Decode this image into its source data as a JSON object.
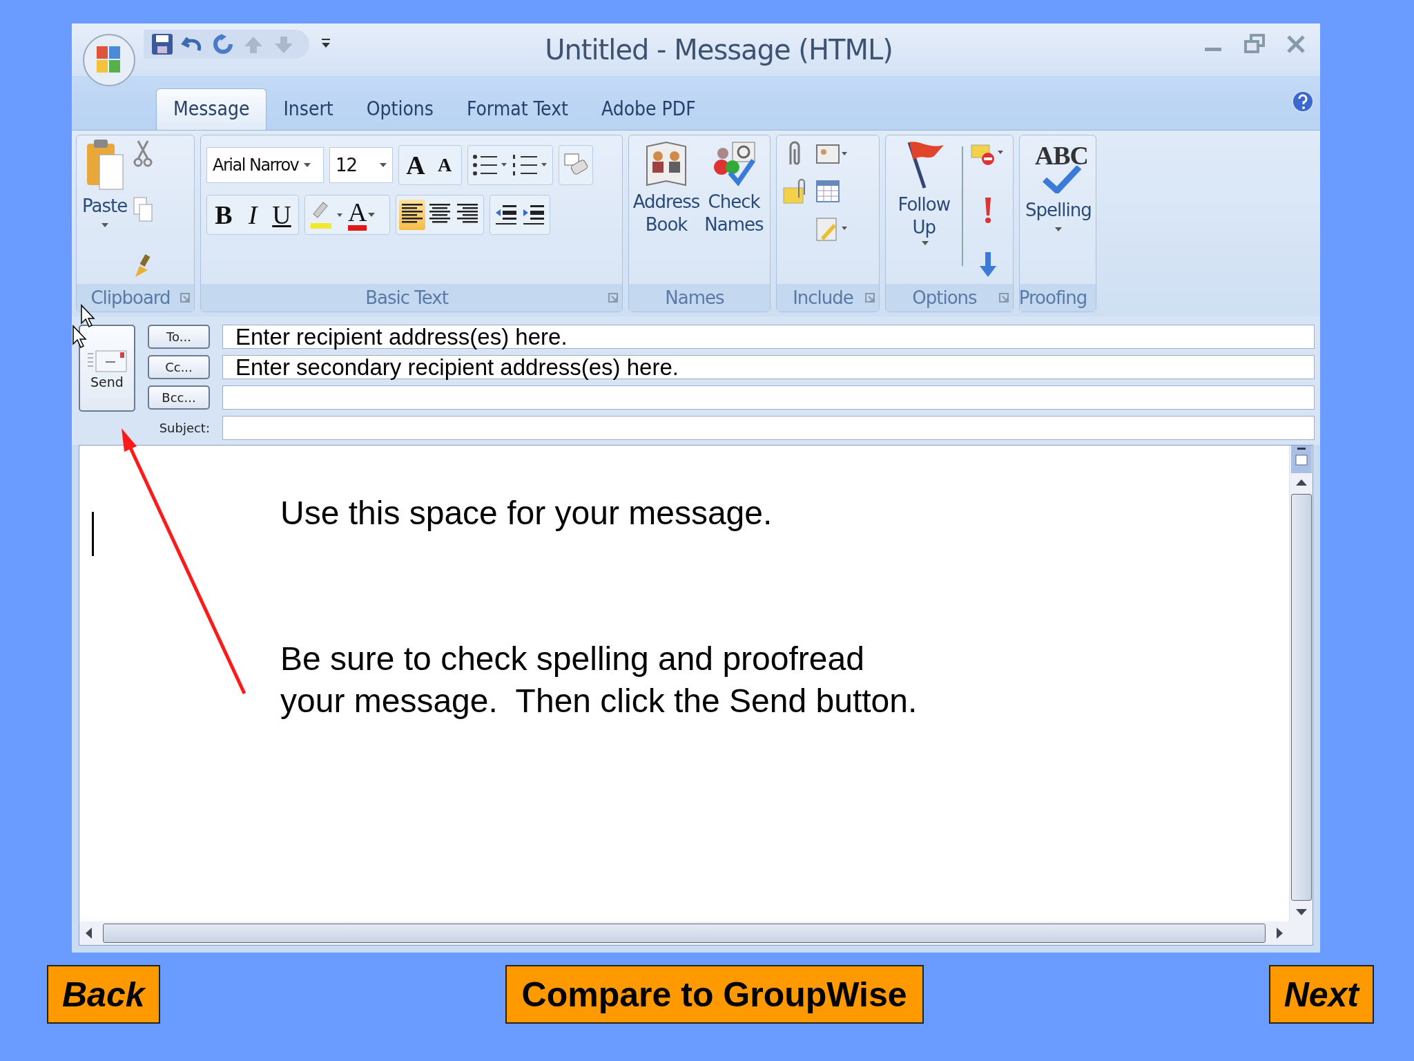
{
  "window": {
    "title": "Untitled - Message (HTML)"
  },
  "tabs": [
    {
      "label": "Message",
      "selected": true
    },
    {
      "label": "Insert",
      "selected": false
    },
    {
      "label": "Options",
      "selected": false
    },
    {
      "label": "Format Text",
      "selected": false
    },
    {
      "label": "Adobe PDF",
      "selected": false
    }
  ],
  "ribbon": {
    "clipboard": {
      "label": "Clipboard",
      "paste": "Paste"
    },
    "basic_text": {
      "label": "Basic Text",
      "font": "Arial Narrov",
      "size": "12",
      "grow": "A",
      "shrink": "A",
      "bold": "B",
      "italic": "I",
      "underline": "U",
      "font_color": "A",
      "alignments": [
        {
          "selected": true
        },
        {
          "selected": false
        },
        {
          "selected": false
        }
      ]
    },
    "names": {
      "label": "Names",
      "buttons": [
        "Address Book",
        "Check Names"
      ]
    },
    "include": {
      "label": "Include"
    },
    "options": {
      "label": "Options",
      "follow_up": "Follow Up"
    },
    "proofing": {
      "label": "Proofing",
      "spelling_icon": "ABC",
      "spelling": "Spelling"
    }
  },
  "send": "Send",
  "recipients": [
    {
      "button": "To...",
      "value": "Enter recipient address(es) here."
    },
    {
      "button": "Cc...",
      "value": "Enter secondary recipient address(es) here."
    },
    {
      "button": "Bcc..."
    }
  ],
  "subject": {
    "label": "Subject:"
  },
  "body": [
    "Use this space for your message.",
    "Be sure to check spelling and proofread\nyour message.  Then click the Send button."
  ],
  "nav_buttons": [
    "Back",
    "Compare to GroupWise",
    "Next"
  ]
}
